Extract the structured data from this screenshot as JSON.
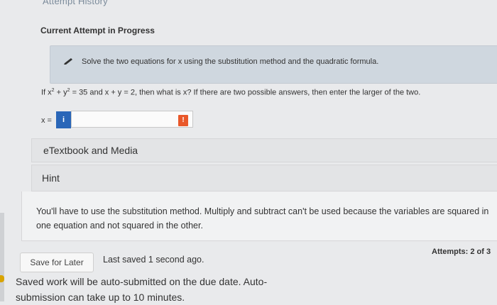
{
  "header": {
    "top_link": "Attempt History",
    "attempt_title": "Current Attempt in Progress"
  },
  "instruction": {
    "icon": "pencil-icon",
    "text": "Solve the two equations for x using the substitution method and the quadratic formula."
  },
  "question": {
    "prefix": "If x",
    "exp1": "2",
    "mid": " + y",
    "exp2": "2",
    "rest": " = 35 and x + y = 2, then what is x? If there are two possible answers, then enter the larger of the two."
  },
  "answer": {
    "label": "x =",
    "info_glyph": "i",
    "alert_glyph": "!",
    "value": ""
  },
  "resources": {
    "etextbook_label": "eTextbook and Media",
    "hint_label": "Hint",
    "hint_text": "You'll have to use the substitution method. Multiply and subtract can't be used because the variables are squared in one equation and not squared in the other."
  },
  "footer": {
    "save_button": "Save for Later",
    "last_saved": "Last saved 1 second ago.",
    "attempts": "Attempts: 2 of 3",
    "auto_submit_note": "Saved work will be auto-submitted on the due date. Auto-submission can take up to 10 minutes."
  }
}
